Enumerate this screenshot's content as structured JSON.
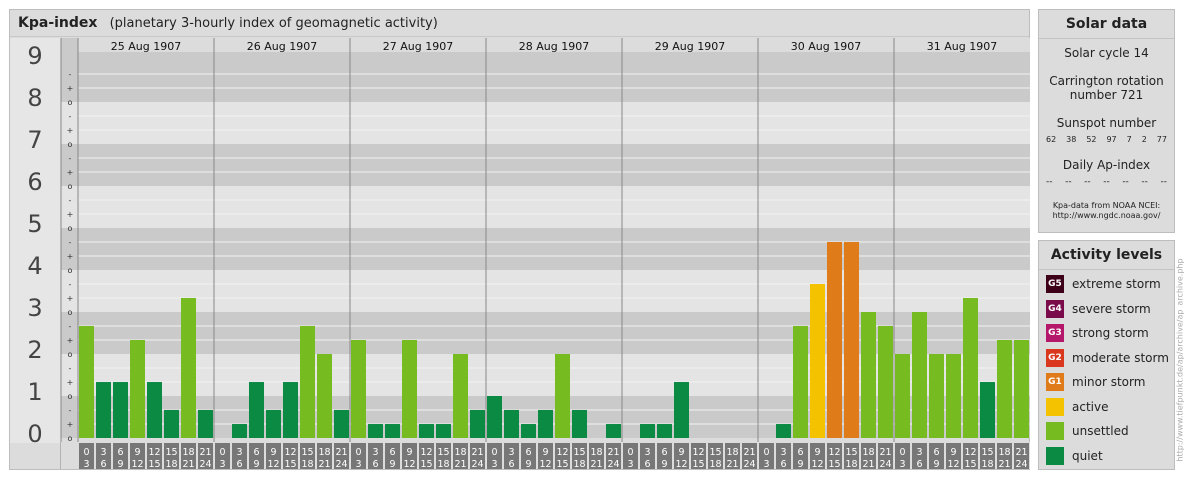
{
  "header": {
    "title": "Kpa-index",
    "subtitle": "(planetary 3-hourly index of geomagnetic activity)"
  },
  "chart_data": {
    "type": "bar",
    "title": "Kpa-index",
    "subtitle": "(planetary 3-hourly index of geomagnetic activity)",
    "ylim": [
      0,
      9
    ],
    "y_ticks": [
      "0",
      "1",
      "2",
      "3",
      "4",
      "5",
      "6",
      "7",
      "8",
      "9"
    ],
    "y_minor_ticks": [
      "o",
      "+",
      "-"
    ],
    "days": [
      "25 Aug 1907",
      "26 Aug 1907",
      "27 Aug 1907",
      "28 Aug 1907",
      "29 Aug 1907",
      "30 Aug 1907",
      "31 Aug 1907"
    ],
    "interval_starts": [
      "0",
      "3",
      "6",
      "9",
      "12",
      "15",
      "18",
      "21"
    ],
    "interval_ends": [
      "3",
      "6",
      "9",
      "12",
      "15",
      "18",
      "21",
      "24"
    ],
    "values": [
      [
        2.667,
        1.333,
        1.333,
        2.333,
        1.333,
        0.667,
        3.333,
        0.667
      ],
      [
        0.0,
        0.333,
        1.333,
        0.667,
        1.333,
        2.667,
        2.0,
        0.667
      ],
      [
        2.333,
        0.333,
        0.333,
        2.333,
        0.333,
        0.333,
        2.0,
        0.667
      ],
      [
        1.0,
        0.667,
        0.333,
        0.667,
        2.0,
        0.667,
        0.0,
        0.333
      ],
      [
        0.0,
        0.333,
        0.333,
        1.333,
        0.0,
        0.0,
        0.0,
        0.0
      ],
      [
        0.0,
        0.333,
        2.667,
        3.667,
        4.667,
        4.667,
        3.0,
        2.667
      ],
      [
        2.0,
        3.0,
        2.0,
        2.0,
        3.333,
        1.333,
        2.333,
        2.333
      ]
    ],
    "colors": {
      "quiet": "#0b8a44",
      "unsettled": "#76bc21",
      "active": "#f5c200",
      "minor_storm": "#e07b1a"
    },
    "background_bands": [
      "#cacaca",
      "#e4e4e4"
    ]
  },
  "solar": {
    "title": "Solar data",
    "cycle": "Solar cycle 14",
    "carrington_line1": "Carrington rotation",
    "carrington_line2": "number 721",
    "sunspot_title": "Sunspot number",
    "sunspots": [
      "62",
      "38",
      "52",
      "97",
      "7",
      "2",
      "77"
    ],
    "ap_title": "Daily Ap-index",
    "ap_values": [
      "--",
      "--",
      "--",
      "--",
      "--",
      "--",
      "--"
    ],
    "source_line1": "Kpa-data from NOAA NCEI:",
    "source_line2": "http://www.ngdc.noaa.gov/"
  },
  "activity": {
    "title": "Activity levels",
    "levels": [
      {
        "badge": "G5",
        "label": "extreme storm",
        "color": "#3d0018"
      },
      {
        "badge": "G4",
        "label": "severe storm",
        "color": "#7b0a4b"
      },
      {
        "badge": "G3",
        "label": "strong storm",
        "color": "#b5186b"
      },
      {
        "badge": "G2",
        "label": "moderate storm",
        "color": "#d9381e"
      },
      {
        "badge": "G1",
        "label": "minor storm",
        "color": "#e07b1a"
      },
      {
        "badge": "",
        "label": "active",
        "color": "#f5c200"
      },
      {
        "badge": "",
        "label": "unsettled",
        "color": "#76bc21"
      },
      {
        "badge": "",
        "label": "quiet",
        "color": "#0b8a44"
      }
    ]
  },
  "footer": {
    "vertical_url": "http://www.tiefpunkt.de/ap/archive/ap_archive.php"
  }
}
